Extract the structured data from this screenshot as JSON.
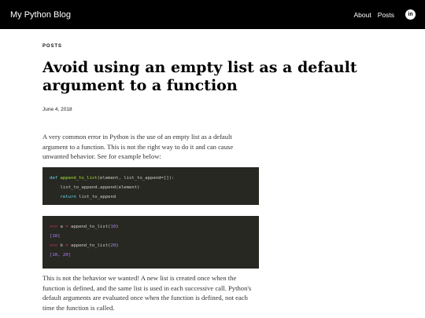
{
  "header": {
    "site_title": "My Python Blog",
    "nav": [
      {
        "label": "About"
      },
      {
        "label": "Posts"
      }
    ],
    "linkedin_label": "in"
  },
  "post": {
    "category": "POSTS",
    "title": "Avoid using an empty list as a default argument to a function",
    "date": "June 4, 2018",
    "intro": "A very common error in Python is the use of an empty list as a default argument to a function. This is not the right way to do it and can cause unwanted behavior. See for example below:",
    "code1": {
      "line1": {
        "kw": "def",
        "fn": "append_to_list",
        "rest": "(element, list_to_append=[]):"
      },
      "line2": "list_to_append.append(element)",
      "line3": {
        "kw": "return",
        "rest": " list_to_append"
      }
    },
    "code2": {
      "line1": {
        "prompt": ">>>",
        "var": " a ",
        "op": "=",
        "call": " append_to_list(",
        "num": "10",
        "close": ")"
      },
      "line2": "[10]",
      "line3": {
        "prompt": ">>>",
        "var": " b ",
        "op": "=",
        "call": " append_to_list(",
        "num": "20",
        "close": ")"
      },
      "line4": "[10, 20]"
    },
    "after": "This is not the behavior we wanted! A new list is created once when the function is defined, and the same list is used in each successive call. Python's default arguments are evaluated once when the function is defined, not each time the function is called."
  },
  "colors": {
    "navbar_bg": "#000000",
    "code_bg": "#272822",
    "keyword": "#66d9ef",
    "function": "#a6e22e",
    "number": "#ae81ff",
    "operator": "#f92672"
  }
}
